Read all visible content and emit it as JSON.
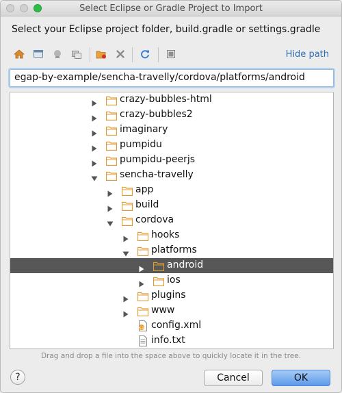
{
  "window": {
    "title": "Select Eclipse or Gradle Project to Import"
  },
  "heading": "Select your Eclipse project folder, build.gradle or settings.gradle",
  "toolbar": {
    "icons": [
      "home-icon",
      "desktop-icon",
      "module-icon",
      "new-folder-icon",
      "delete-icon",
      "refresh-icon",
      "toggle-hidden-icon"
    ],
    "hide_path": "Hide path"
  },
  "path": {
    "value": "egap-by-example/sencha-travelly/cordova/platforms/android"
  },
  "tree": {
    "rows": [
      {
        "label": "crazy-bubbles-html",
        "type": "folder",
        "arrow": "collapsed",
        "depth": 0,
        "selected": false
      },
      {
        "label": "crazy-bubbles2",
        "type": "folder",
        "arrow": "collapsed",
        "depth": 0,
        "selected": false
      },
      {
        "label": "imaginary",
        "type": "folder",
        "arrow": "collapsed",
        "depth": 0,
        "selected": false
      },
      {
        "label": "pumpidu",
        "type": "folder",
        "arrow": "collapsed",
        "depth": 0,
        "selected": false
      },
      {
        "label": "pumpidu-peerjs",
        "type": "folder",
        "arrow": "collapsed",
        "depth": 0,
        "selected": false
      },
      {
        "label": "sencha-travelly",
        "type": "folder",
        "arrow": "expanded",
        "depth": 0,
        "selected": false
      },
      {
        "label": "app",
        "type": "folder",
        "arrow": "collapsed",
        "depth": 1,
        "selected": false
      },
      {
        "label": "build",
        "type": "folder",
        "arrow": "collapsed",
        "depth": 1,
        "selected": false
      },
      {
        "label": "cordova",
        "type": "folder",
        "arrow": "expanded",
        "depth": 1,
        "selected": false
      },
      {
        "label": "hooks",
        "type": "folder",
        "arrow": "collapsed",
        "depth": 2,
        "selected": false
      },
      {
        "label": "platforms",
        "type": "folder",
        "arrow": "expanded",
        "depth": 2,
        "selected": false
      },
      {
        "label": "android",
        "type": "folder",
        "arrow": "collapsed",
        "depth": 3,
        "selected": true
      },
      {
        "label": "ios",
        "type": "folder",
        "arrow": "collapsed",
        "depth": 3,
        "selected": false
      },
      {
        "label": "plugins",
        "type": "folder",
        "arrow": "collapsed",
        "depth": 2,
        "selected": false
      },
      {
        "label": "www",
        "type": "folder",
        "arrow": "collapsed",
        "depth": 2,
        "selected": false
      },
      {
        "label": "config.xml",
        "type": "xml",
        "arrow": "none",
        "depth": 2,
        "selected": false
      },
      {
        "label": "info.txt",
        "type": "txt",
        "arrow": "none",
        "depth": 2,
        "selected": false
      }
    ]
  },
  "hint": "Drag and drop a file into the space above to quickly locate it in the tree.",
  "buttons": {
    "help": "?",
    "cancel": "Cancel",
    "ok": "OK"
  },
  "colors": {
    "folder": "#e9a23b",
    "selection": "#575757",
    "link": "#2f6fb3",
    "ok_button": "#5c9aea"
  }
}
